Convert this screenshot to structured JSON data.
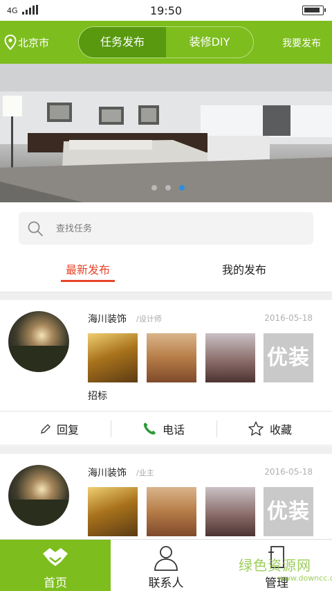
{
  "status_bar": {
    "network": "4G",
    "time": "19:50"
  },
  "header": {
    "city": "北京市",
    "segments": [
      "任务发布",
      "装修DIY"
    ],
    "publish_label": "我要发布"
  },
  "banner": {
    "slide_count": 3,
    "active_slide": 3
  },
  "search": {
    "placeholder": "查找任务"
  },
  "tabs": [
    "最新发布",
    "我的发布"
  ],
  "posts": [
    {
      "name": "海川装饰",
      "role": "/设计师",
      "date": "2016-05-18",
      "thumb_badge": "优装",
      "desc": "招标"
    },
    {
      "name": "海川装饰",
      "role": "/业主",
      "date": "2016-05-18",
      "thumb_badge": "优装"
    }
  ],
  "actions": {
    "reply": "回复",
    "phone": "电话",
    "favorite": "收藏"
  },
  "bottom_nav": [
    "首页",
    "联系人",
    "管理"
  ],
  "watermark": {
    "text": "绿色资源网",
    "url": "www.downcc.com"
  },
  "colors": {
    "brand_green": "#7dbd1d",
    "active_segment": "#58990f",
    "tab_active": "#e8452a",
    "dot_active": "#2c8ee0"
  }
}
